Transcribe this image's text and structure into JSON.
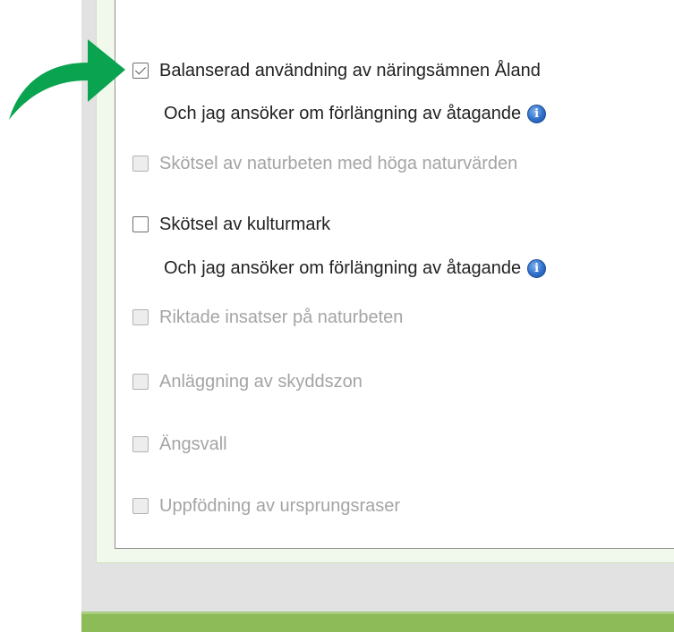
{
  "options": [
    {
      "label": "Balanserad användning av näringsämnen Åland",
      "checked": true,
      "disabled": false
    },
    {
      "label": "Skötsel av naturbeten med höga naturvärden",
      "checked": false,
      "disabled": true
    },
    {
      "label": "Skötsel av kulturmark",
      "checked": false,
      "disabled": false
    },
    {
      "label": "Riktade insatser på naturbeten",
      "checked": false,
      "disabled": true
    },
    {
      "label": "Anläggning av skyddszon",
      "checked": false,
      "disabled": true
    },
    {
      "label": "Ängsvall",
      "checked": false,
      "disabled": true
    },
    {
      "label": "Uppfödning av ursprungsraser",
      "checked": false,
      "disabled": true
    }
  ],
  "extension": {
    "label_1": "Och jag ansöker om förlängning av åtagande",
    "label_2": "Och jag ansöker om förlängning av åtagande",
    "info_glyph": "i"
  },
  "annotation": {
    "arrow_color": "#0aa34f",
    "icon": "curved-arrow-icon"
  },
  "colors": {
    "footer_green": "#8dbb58",
    "panel_gray": "#e2e2e2",
    "light_green": "#f1f9ec",
    "info_blue": "#2f6fc9"
  }
}
